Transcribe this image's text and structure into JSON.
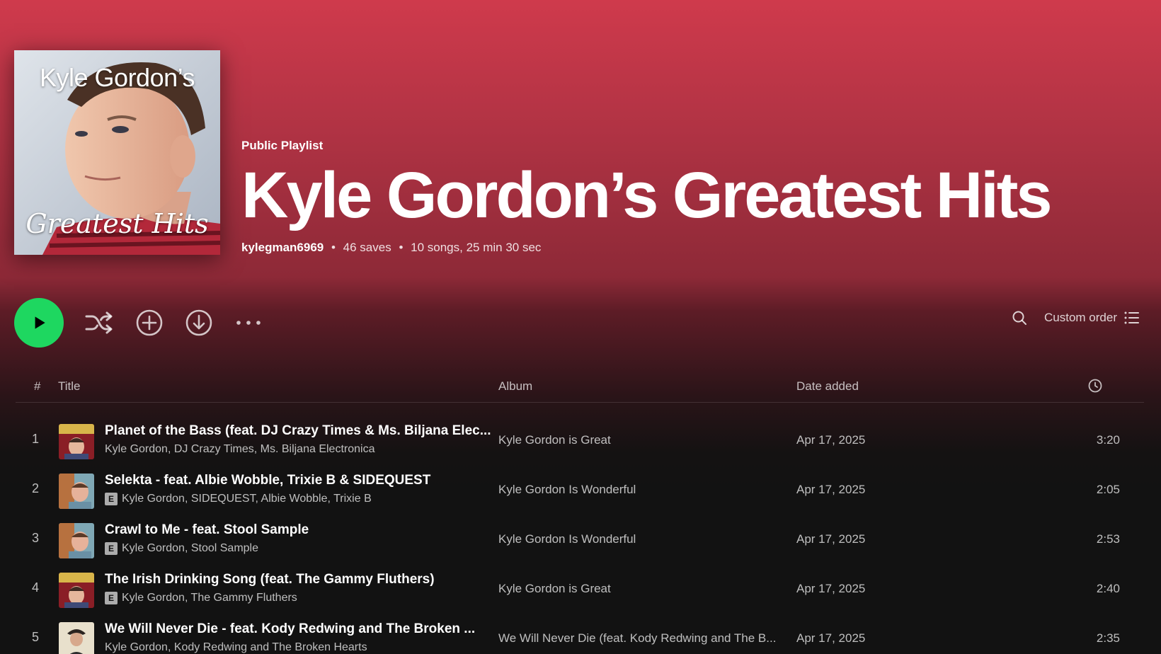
{
  "playlist": {
    "kind": "Public Playlist",
    "title": "Kyle Gordon’s Greatest Hits",
    "owner": "kylegman6969",
    "saves": "46 saves",
    "summary": "10 songs, 25 min 30 sec",
    "cover": {
      "top_text": "Kyle Gordon’s",
      "bottom_text": "Greatest Hits"
    }
  },
  "actions": {
    "play_icon": "play-icon",
    "shuffle_icon": "shuffle-icon",
    "add_icon": "add-circle-icon",
    "download_icon": "download-icon",
    "more_icon": "more-horizontal-icon",
    "search_icon": "search-icon",
    "sort_label": "Custom order",
    "sort_icon": "list-icon"
  },
  "table": {
    "headers": {
      "num": "#",
      "title": "Title",
      "album": "Album",
      "date": "Date added",
      "duration_icon": "clock-icon"
    },
    "rows": [
      {
        "num": "1",
        "title": "Planet of the Bass (feat. DJ Crazy Times & Ms. Biljana Elec...",
        "explicit": false,
        "artists": "Kyle Gordon, DJ Crazy Times, Ms. Biljana Electronica",
        "album": "Kyle Gordon is Great",
        "date": "Apr 17, 2025",
        "duration": "3:20"
      },
      {
        "num": "2",
        "title": "Selekta - feat. Albie Wobble, Trixie B & SIDEQUEST",
        "explicit": true,
        "artists": "Kyle Gordon, SIDEQUEST, Albie Wobble, Trixie B",
        "album": "Kyle Gordon Is Wonderful",
        "date": "Apr 17, 2025",
        "duration": "2:05"
      },
      {
        "num": "3",
        "title": "Crawl to Me - feat. Stool Sample",
        "explicit": true,
        "artists": "Kyle Gordon, Stool Sample",
        "album": "Kyle Gordon Is Wonderful",
        "date": "Apr 17, 2025",
        "duration": "2:53"
      },
      {
        "num": "4",
        "title": "The Irish Drinking Song (feat. The Gammy Fluthers)",
        "explicit": true,
        "artists": "Kyle Gordon, The Gammy Fluthers",
        "album": "Kyle Gordon is Great",
        "date": "Apr 17, 2025",
        "duration": "2:40"
      },
      {
        "num": "5",
        "title": "We Will Never Die - feat. Kody Redwing and The Broken ...",
        "explicit": false,
        "artists": "Kyle Gordon, Kody Redwing and The Broken Hearts",
        "album": "We Will Never Die (feat. Kody Redwing and The B...",
        "date": "Apr 17, 2025",
        "duration": "2:35"
      }
    ]
  },
  "colors": {
    "accent": "#1ed760",
    "header_top": "#cf3a4c",
    "background": "#121212"
  }
}
